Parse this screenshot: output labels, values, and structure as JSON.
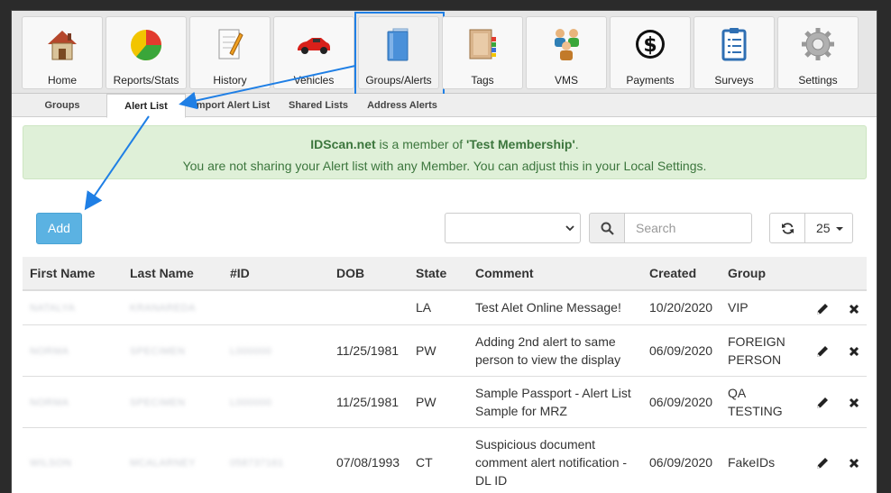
{
  "nav": {
    "items": [
      {
        "label": "Home",
        "icon": "house-icon"
      },
      {
        "label": "Reports/Stats",
        "icon": "pie-chart-icon"
      },
      {
        "label": "History",
        "icon": "document-pencil-icon"
      },
      {
        "label": "Vehicles",
        "icon": "car-icon"
      },
      {
        "label": "Groups/Alerts",
        "icon": "folder-icon",
        "active": true
      },
      {
        "label": "Tags",
        "icon": "tags-icon"
      },
      {
        "label": "VMS",
        "icon": "people-icon"
      },
      {
        "label": "Payments",
        "icon": "dollar-icon"
      },
      {
        "label": "Surveys",
        "icon": "clipboard-icon"
      },
      {
        "label": "Settings",
        "icon": "gear-icon"
      }
    ]
  },
  "subtabs": [
    {
      "label": "Groups"
    },
    {
      "label": "Alert List",
      "active": true
    },
    {
      "label": "Import Alert List"
    },
    {
      "label": "Shared Lists"
    },
    {
      "label": "Address Alerts"
    }
  ],
  "alert": {
    "org": "IDScan.net",
    "mid": " is a member of ",
    "membership": "'Test Membership'",
    "end": ".",
    "line2": "You are not sharing your Alert list with any Member. You can adjust this in your Local Settings."
  },
  "toolbar": {
    "add_label": "Add",
    "select_value": "",
    "search_placeholder": "Search",
    "page_size": "25"
  },
  "colors": {
    "accent_border": "#1f7fe5",
    "add_button": "#5bb2e2",
    "alert_bg": "#dff0d8",
    "alert_text": "#3c763d"
  },
  "table": {
    "headers": [
      "First Name",
      "Last Name",
      "#ID",
      "DOB",
      "State",
      "Comment",
      "Created",
      "Group"
    ],
    "rows": [
      {
        "first": "NATALYA",
        "last": "KRANAREDA",
        "id": "",
        "dob": "",
        "state": "LA",
        "comment": [
          "Test Alet Online Message!"
        ],
        "created": "10/20/2020",
        "group": [
          "VIP"
        ]
      },
      {
        "first": "NORMA",
        "last": "SPECIMEN",
        "id": "L000000",
        "dob": "11/25/1981",
        "state": "PW",
        "comment": [
          "Adding 2nd alert to same",
          "person to view the display"
        ],
        "created": "06/09/2020",
        "group": [
          "FOREIGN",
          "PERSON"
        ]
      },
      {
        "first": "NORMA",
        "last": "SPECIMEN",
        "id": "L000000",
        "dob": "11/25/1981",
        "state": "PW",
        "comment": [
          "Sample Passport - Alert List",
          "Sample for MRZ"
        ],
        "created": "06/09/2020",
        "group": [
          "QA",
          "TESTING"
        ]
      },
      {
        "first": "WILSON",
        "last": "MCALARNEY",
        "id": "058737161",
        "dob": "07/08/1993",
        "state": "CT",
        "comment": [
          "Suspicious document",
          "comment alert notification -",
          "DL ID"
        ],
        "created": "06/09/2020",
        "group": [
          "FakeIDs"
        ]
      }
    ]
  }
}
